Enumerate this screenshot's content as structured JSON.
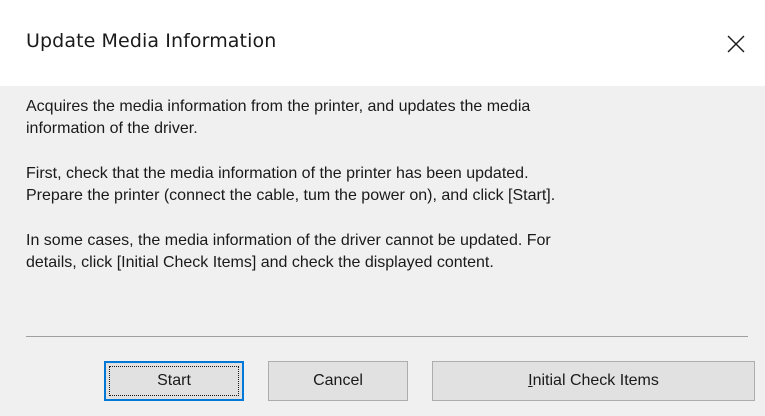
{
  "window": {
    "title": "Update Media Information",
    "close_icon": "close-icon"
  },
  "content": {
    "paragraph1": "Acquires the media information from the printer, and updates the media\ninformation of the driver.",
    "paragraph2": "First, check that the media information of the printer has been updated.\nPrepare the printer (connect the cable, tum the power on), and click [Start].",
    "paragraph3": "In some cases, the media information of the driver cannot be updated. For\ndetails, click [Initial Check Items] and check the displayed content."
  },
  "buttons": {
    "start_label": "Start",
    "cancel_label": "Cancel",
    "initial_check_mnemonic": "I",
    "initial_check_rest": "nitial Check Items"
  },
  "colors": {
    "dialog_bg": "#f0f0f0",
    "titlebar_bg": "#ffffff",
    "default_button_border": "#0078d7",
    "button_bg": "#e1e1e1"
  }
}
